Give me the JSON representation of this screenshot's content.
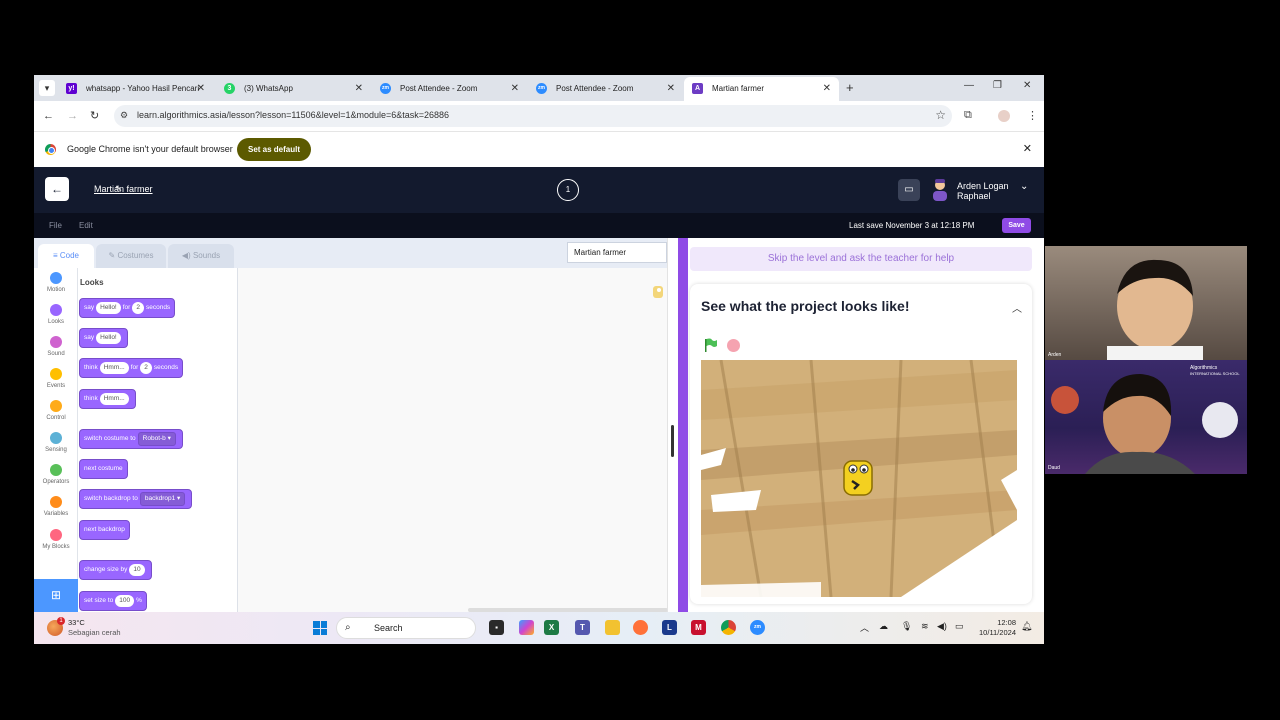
{
  "browser": {
    "tabs": [
      {
        "title": "whatsapp - Yahoo Hasil Pencari",
        "favicon": "yahoo-icon",
        "color": "#5f01d1",
        "glyph": "y!"
      },
      {
        "title": "(3) WhatsApp",
        "favicon": "whatsapp-icon",
        "color": "#25d366",
        "glyph": "3"
      },
      {
        "title": "Post Attendee - Zoom",
        "favicon": "zoom-icon",
        "color": "#2d8cff",
        "glyph": "zm"
      },
      {
        "title": "Post Attendee - Zoom",
        "favicon": "zoom-icon",
        "color": "#2d8cff",
        "glyph": "zm"
      },
      {
        "title": "Martian farmer",
        "favicon": "algorithmics-icon",
        "color": "#6d3cc4",
        "glyph": "A"
      }
    ],
    "url": "learn.algorithmics.asia/lesson?lesson=11506&level=1&module=6&task=26886",
    "infobar": {
      "message": "Google Chrome isn't your default browser",
      "button": "Set as default"
    }
  },
  "app": {
    "lesson_title": "Martian farmer",
    "level_number": "1",
    "user_name_line1": "Arden Logan",
    "user_name_line2": "Raphael",
    "menu": {
      "file": "File",
      "edit": "Edit"
    },
    "last_save": "Last save November 3 at 12:18 PM",
    "save_label": "Save"
  },
  "editor": {
    "tabs": {
      "code": "Code",
      "costumes": "Costumes",
      "sounds": "Sounds"
    },
    "sprite_name": "Martian farmer",
    "categories": [
      {
        "label": "Motion",
        "color": "#4c97ff"
      },
      {
        "label": "Looks",
        "color": "#9966ff"
      },
      {
        "label": "Sound",
        "color": "#cf63cf"
      },
      {
        "label": "Events",
        "color": "#ffbf00"
      },
      {
        "label": "Control",
        "color": "#ffab19"
      },
      {
        "label": "Sensing",
        "color": "#5cb1d6"
      },
      {
        "label": "Operators",
        "color": "#59c059"
      },
      {
        "label": "Variables",
        "color": "#ff8c1a"
      },
      {
        "label": "My Blocks",
        "color": "#ff6680"
      }
    ],
    "palette_title": "Looks",
    "blocks": {
      "say_for": {
        "w1": "say",
        "v1": "Hello!",
        "w2": "for",
        "v2": "2",
        "w3": "seconds"
      },
      "say": {
        "w1": "say",
        "v1": "Hello!"
      },
      "think_for": {
        "w1": "think",
        "v1": "Hmm...",
        "w2": "for",
        "v2": "2",
        "w3": "seconds"
      },
      "think": {
        "w1": "think",
        "v1": "Hmm..."
      },
      "switch_costume": {
        "w1": "switch costume to",
        "v1": "Robot-b"
      },
      "next_costume": {
        "w1": "next costume"
      },
      "switch_backdrop": {
        "w1": "switch backdrop to",
        "v1": "backdrop1"
      },
      "next_backdrop": {
        "w1": "next backdrop"
      },
      "change_size": {
        "w1": "change size by",
        "v1": "10"
      },
      "set_size": {
        "w1": "set size to",
        "v1": "100",
        "w2": "%"
      }
    }
  },
  "panel": {
    "skip_label": "Skip the level and ask the teacher for help",
    "card_title": "See what the project looks like!"
  },
  "taskbar": {
    "temperature": "33°C",
    "weather": "Sebagian cerah",
    "weather_badge": "1",
    "search_label": "Search",
    "time": "12:08",
    "date": "10/11/2024"
  },
  "webcam": {
    "top_name": "Arden",
    "bottom_name": "Daud",
    "banner_line1": "Algorithmics",
    "banner_line2": "INTERNATIONAL SCHOOL"
  }
}
